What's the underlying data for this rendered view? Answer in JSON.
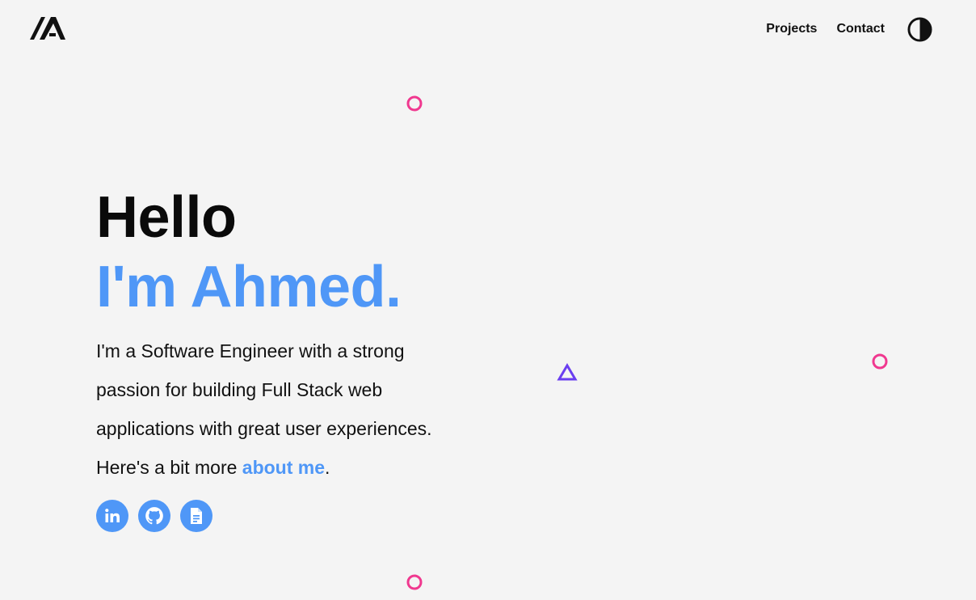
{
  "header": {
    "logo": "IA",
    "nav": [
      "Projects",
      "Contact"
    ],
    "theme_toggle_icon": "contrast-icon"
  },
  "hero": {
    "greeting": "Hello",
    "name": "I'm Ahmed.",
    "bio_lines": [
      "I'm a Software Engineer with a strong",
      "passion for building Full Stack web",
      "applications with great user experiences."
    ],
    "bio_prefix": "Here's a bit more ",
    "about_link": "about me",
    "bio_suffix": "."
  },
  "social_icons": [
    "linkedin-icon",
    "github-icon",
    "resume-document-icon"
  ],
  "colors": {
    "background": "#f4f4f4",
    "accent_blue": "#4f97f7",
    "deco_pink": "#f0388f",
    "deco_purple": "#6a3ef0",
    "text": "#111111"
  }
}
